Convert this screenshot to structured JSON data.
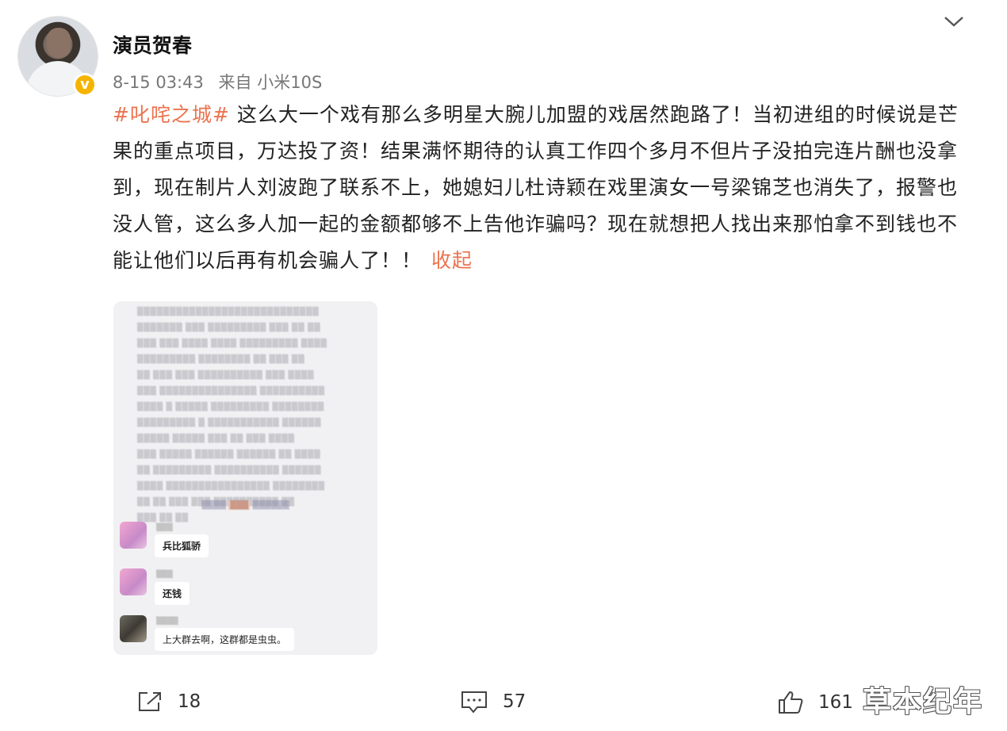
{
  "post": {
    "author": "演员贺春",
    "time": "8-15 03:43",
    "source": "来自 小米10S",
    "hashtag": "#叱咤之城#",
    "body": " 这么大一个戏有那么多明星大腕儿加盟的戏居然跑路了！当初进组的时候说是芒果的重点项目，万达投了资！结果满怀期待的认真工作四个多月不但片子没拍完连片酬也没拿到，现在制片人刘波跑了联系不上，她媳妇儿杜诗颖在戏里演女一号梁锦芝也消失了，报警也没人管，这么多人加一起的金额都够不上告他诈骗吗？现在就想把人找出来那怕拿不到钱也不能让他们以后再有机会骗人了！！",
    "collapse_label": "收起"
  },
  "screenshot": {
    "messages": [
      {
        "text": "兵比狐骄"
      },
      {
        "text": "还钱"
      },
      {
        "text": "上大群去啊，这群都是虫虫。"
      }
    ]
  },
  "actions": {
    "repost_count": "18",
    "comment_count": "57",
    "like_count": "161"
  },
  "watermark": "草本纪年",
  "colors": {
    "accent": "#eb7350",
    "verified": "#f5b400"
  },
  "icons": {
    "verified": "verified-badge-icon",
    "more": "chevron-down-icon",
    "repost": "repost-icon",
    "comment": "comment-icon",
    "like": "like-icon"
  }
}
